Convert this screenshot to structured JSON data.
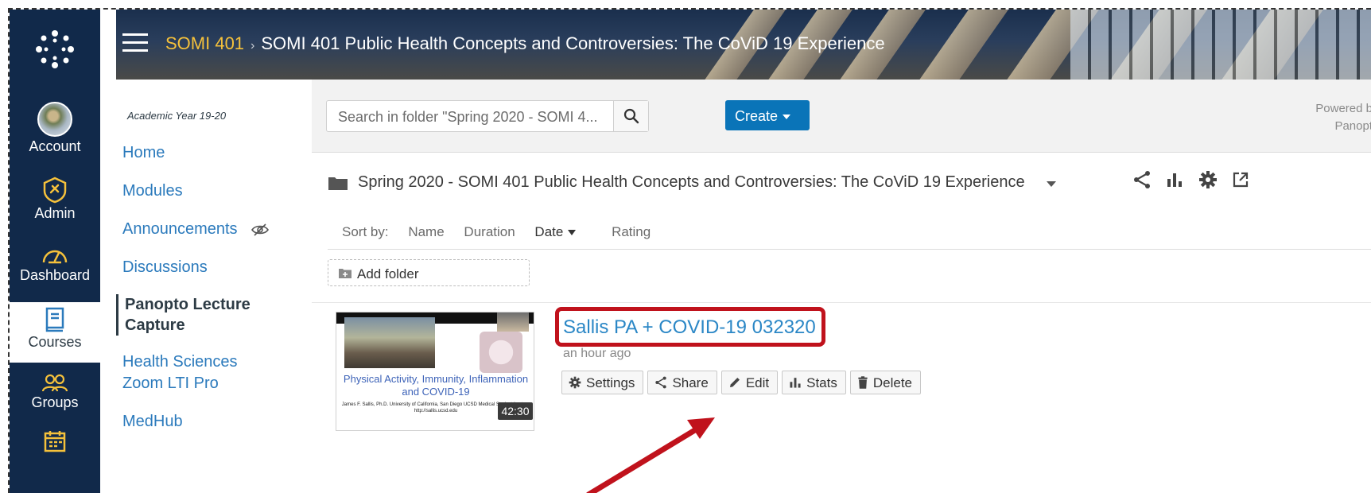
{
  "global_nav": {
    "items": [
      {
        "label": "Account"
      },
      {
        "label": "Admin"
      },
      {
        "label": "Dashboard"
      },
      {
        "label": "Courses"
      },
      {
        "label": "Groups"
      }
    ]
  },
  "header": {
    "course_code": "SOMI 401",
    "separator": "›",
    "course_title": "SOMI 401 Public Health Concepts and Controversies: The CoViD 19 Experience"
  },
  "course_nav": {
    "academic_year": "Academic Year 19-20",
    "items": [
      {
        "label": "Home"
      },
      {
        "label": "Modules"
      },
      {
        "label": "Announcements"
      },
      {
        "label": "Discussions"
      },
      {
        "label": "Panopto Lecture Capture"
      },
      {
        "label": "Health Sciences Zoom LTI Pro"
      },
      {
        "label": "MedHub"
      }
    ]
  },
  "panopto": {
    "search_placeholder": "Search in folder \"Spring 2020 - SOMI 4...",
    "create_label": "Create",
    "powered_by_line1": "Powered b",
    "powered_by_line2": "Panopt",
    "folder_name": "Spring 2020 - SOMI 401 Public Health Concepts and Controversies: The CoViD 19 Experience",
    "sort": {
      "label": "Sort by:",
      "options": [
        "Name",
        "Duration",
        "Date",
        "Rating"
      ]
    },
    "add_folder_label": "Add folder",
    "session": {
      "title": "Sallis PA + COVID-19 032320",
      "time_ago": "an hour ago",
      "duration": "42:30",
      "thumb_title": "Physical Activity, Immunity, Inflammation and COVID-19",
      "thumb_credit": "James F. Sallis, Ph.D. University of California, San Diego UCSD Medical Student Lecture http://sallis.ucsd.edu",
      "actions": [
        "Settings",
        "Share",
        "Edit",
        "Stats",
        "Delete"
      ]
    }
  },
  "colors": {
    "nav_bg": "#11294a",
    "accent_yellow": "#f5c13b",
    "link_blue": "#2b7abc",
    "create_blue": "#0a74b8",
    "highlight_red": "#c0121c"
  }
}
